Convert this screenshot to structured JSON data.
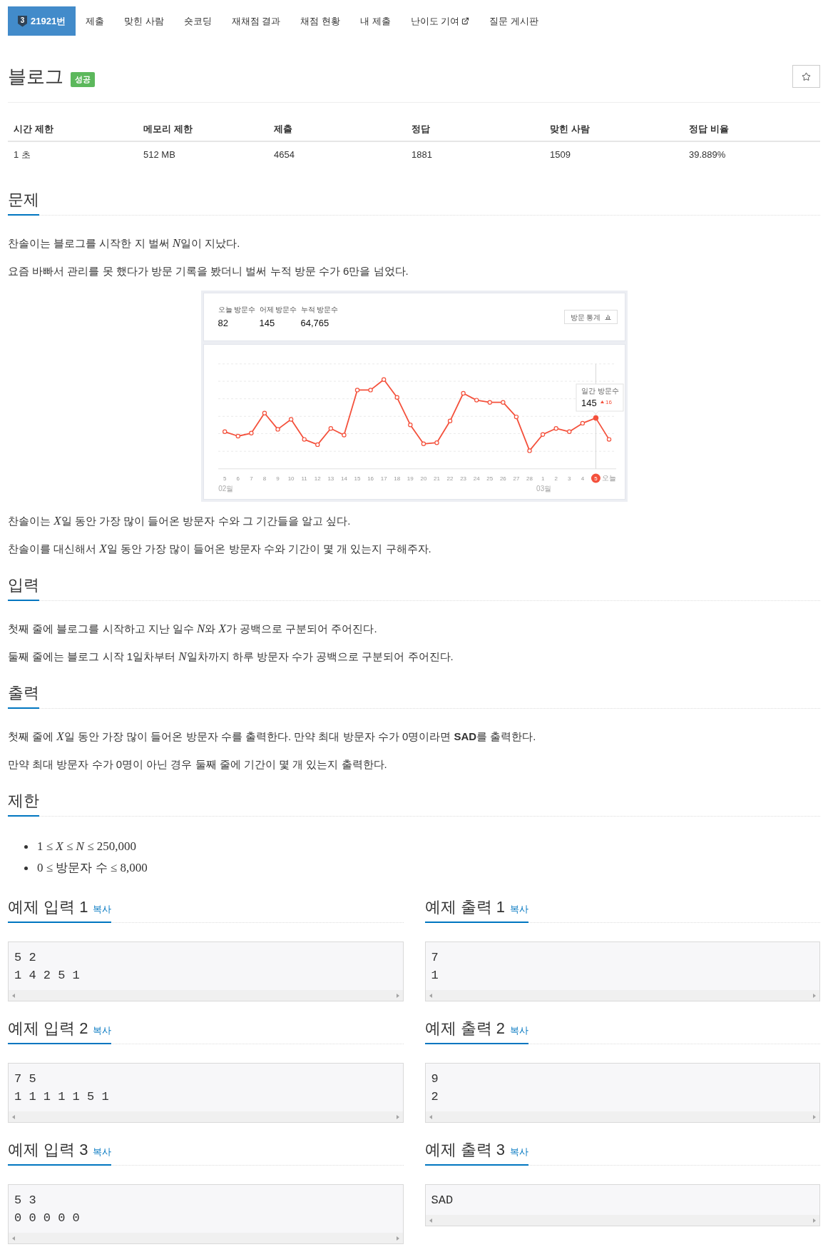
{
  "tabs": [
    {
      "label": "21921번",
      "tier": "3",
      "selected": true,
      "external": false
    },
    {
      "label": "제출",
      "selected": false,
      "external": false
    },
    {
      "label": "맞힌 사람",
      "selected": false,
      "external": false
    },
    {
      "label": "숏코딩",
      "selected": false,
      "external": false
    },
    {
      "label": "재채점 결과",
      "selected": false,
      "external": false
    },
    {
      "label": "채점 현황",
      "selected": false,
      "external": false
    },
    {
      "label": "내 제출",
      "selected": false,
      "external": false
    },
    {
      "label": "난이도 기여",
      "selected": false,
      "external": true
    },
    {
      "label": "질문 게시판",
      "selected": false,
      "external": false
    }
  ],
  "problem_title": "블로그",
  "result_badge": "성공",
  "info_table": {
    "columns": [
      "시간 제한",
      "메모리 제한",
      "제출",
      "정답",
      "맞힌 사람",
      "정답 비율"
    ],
    "rows": [
      [
        "1 초",
        "512 MB",
        "4654",
        "1881",
        "1509",
        "39.889%"
      ]
    ]
  },
  "sections": [
    {
      "heading": "문제",
      "blocks": [
        {
          "kind": "paragraph",
          "parts": [
            {
              "kind": "text",
              "text": "찬솔이는 블로그를 시작한 지 벌써 "
            },
            {
              "kind": "math",
              "text": "N"
            },
            {
              "kind": "text",
              "text": "일이 지났다."
            }
          ]
        },
        {
          "kind": "paragraph",
          "parts": [
            {
              "kind": "text",
              "text": "요즘 바빠서 관리를 못 했다가 방문 기록을 봤더니 벌써 누적 방문 수가 6만을 넘었다."
            }
          ]
        },
        {
          "kind": "stats_screenshot",
          "stats": [
            {
              "label": "오늘 방문수",
              "value": "82"
            },
            {
              "label": "어제 방문수",
              "value": "145"
            },
            {
              "label": "누적 방문수",
              "value": "64,765"
            }
          ],
          "stats_button": "방문 통계",
          "days": [
            {
              "label": "5",
              "month": "02월",
              "selected": false
            },
            {
              "label": "6",
              "selected": false
            },
            {
              "label": "7",
              "selected": false
            },
            {
              "label": "8",
              "selected": false
            },
            {
              "label": "9",
              "selected": false
            },
            {
              "label": "10",
              "selected": false
            },
            {
              "label": "11",
              "selected": false
            },
            {
              "label": "12",
              "selected": false
            },
            {
              "label": "13",
              "selected": false
            },
            {
              "label": "14",
              "selected": false
            },
            {
              "label": "15",
              "selected": false
            },
            {
              "label": "16",
              "selected": false
            },
            {
              "label": "17",
              "selected": false
            },
            {
              "label": "18",
              "selected": false
            },
            {
              "label": "19",
              "selected": false
            },
            {
              "label": "20",
              "selected": false
            },
            {
              "label": "21",
              "selected": false
            },
            {
              "label": "22",
              "selected": false
            },
            {
              "label": "23",
              "selected": false
            },
            {
              "label": "24",
              "selected": false
            },
            {
              "label": "25",
              "selected": false
            },
            {
              "label": "26",
              "selected": false
            },
            {
              "label": "27",
              "selected": false
            },
            {
              "label": "28",
              "selected": false
            },
            {
              "label": "1",
              "month": "03월",
              "selected": false
            },
            {
              "label": "2",
              "selected": false
            },
            {
              "label": "3",
              "selected": false
            },
            {
              "label": "4",
              "selected": false
            },
            {
              "label": "5",
              "selected": true
            },
            {
              "label": "오늘",
              "selected": false
            }
          ],
          "tooltip": {
            "title": "일간 방문수",
            "value": "145",
            "change": "16"
          }
        },
        {
          "kind": "paragraph",
          "parts": [
            {
              "kind": "text",
              "text": "찬솔이는 "
            },
            {
              "kind": "math",
              "text": "X"
            },
            {
              "kind": "text",
              "text": "일 동안 가장 많이 들어온 방문자 수와 그 기간들을 알고 싶다."
            }
          ]
        },
        {
          "kind": "paragraph",
          "parts": [
            {
              "kind": "text",
              "text": "찬솔이를 대신해서 "
            },
            {
              "kind": "math",
              "text": "X"
            },
            {
              "kind": "text",
              "text": "일 동안 가장 많이 들어온 방문자 수와 기간이 몇 개 있는지 구해주자."
            }
          ]
        }
      ]
    },
    {
      "heading": "입력",
      "blocks": [
        {
          "kind": "paragraph",
          "parts": [
            {
              "kind": "text",
              "text": "첫째 줄에 블로그를 시작하고 지난 일수 "
            },
            {
              "kind": "math",
              "text": "N"
            },
            {
              "kind": "text",
              "text": "와 "
            },
            {
              "kind": "math",
              "text": "X"
            },
            {
              "kind": "text",
              "text": "가 공백으로 구분되어 주어진다."
            }
          ]
        },
        {
          "kind": "paragraph",
          "parts": [
            {
              "kind": "text",
              "text": "둘째 줄에는 블로그 시작 1일차부터 "
            },
            {
              "kind": "math",
              "text": "N"
            },
            {
              "kind": "text",
              "text": "일차까지 하루 방문자 수가 공백으로 구분되어 주어진다."
            }
          ]
        }
      ]
    },
    {
      "heading": "출력",
      "blocks": [
        {
          "kind": "paragraph",
          "parts": [
            {
              "kind": "text",
              "text": "첫째 줄에 "
            },
            {
              "kind": "math",
              "text": "X"
            },
            {
              "kind": "text",
              "text": "일 동안 가장 많이 들어온 방문자 수를 출력한다. 만약 최대 방문자 수가 0명이라면 "
            },
            {
              "kind": "bold",
              "text": "SAD"
            },
            {
              "kind": "text",
              "text": "를 출력한다."
            }
          ]
        },
        {
          "kind": "paragraph",
          "parts": [
            {
              "kind": "text",
              "text": "만약 최대 방문자 수가 0명이 아닌 경우 둘째 줄에 기간이 몇 개 있는지 출력한다."
            }
          ]
        }
      ]
    },
    {
      "heading": "제한",
      "blocks": [
        {
          "kind": "bullets",
          "items": [
            "1 ≤ *X* ≤ *N* ≤ 250,000",
            "0 ≤ 방문자 수 ≤ 8,000"
          ]
        }
      ]
    }
  ],
  "samples": [
    {
      "title": "예제 입력 1",
      "copy_link": "복사",
      "text": "5 2\n1 4 2 5 1"
    },
    {
      "title": "예제 출력 1",
      "copy_link": "복사",
      "text": "7\n1"
    },
    {
      "title": "예제 입력 2",
      "copy_link": "복사",
      "text": "7 5\n1 1 1 1 1 5 1"
    },
    {
      "title": "예제 출력 2",
      "copy_link": "복사",
      "text": "9\n2"
    },
    {
      "title": "예제 입력 3",
      "copy_link": "복사",
      "text": "5 3\n0 0 0 0 0"
    },
    {
      "title": "예제 출력 3",
      "copy_link": "복사",
      "text": "SAD"
    }
  ]
}
